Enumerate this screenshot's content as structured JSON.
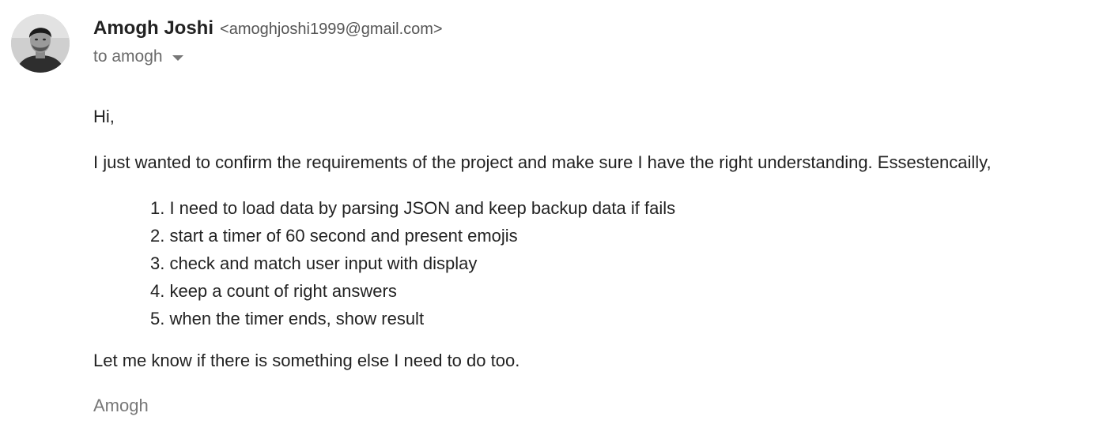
{
  "sender": {
    "name": "Amogh Joshi",
    "email": "<amoghjoshi1999@gmail.com>",
    "avatar_icon": "profile-photo"
  },
  "recipient": {
    "label": "to amogh",
    "toggle_icon": "caret-down-icon"
  },
  "message": {
    "greeting": "Hi,",
    "intro": "I just wanted to confirm the requirements of the project and make sure I have the right understanding. Essestencailly,",
    "requirements": [
      "1. I need to load data by parsing JSON and keep backup data if fails",
      "2. start a timer of 60 second and present emojis",
      "3. check and match user input with display",
      "4. keep a count of right answers",
      "5. when the timer ends, show result"
    ],
    "closing": "Let me know if there is something else I need to do too.",
    "signature": "Amogh"
  }
}
